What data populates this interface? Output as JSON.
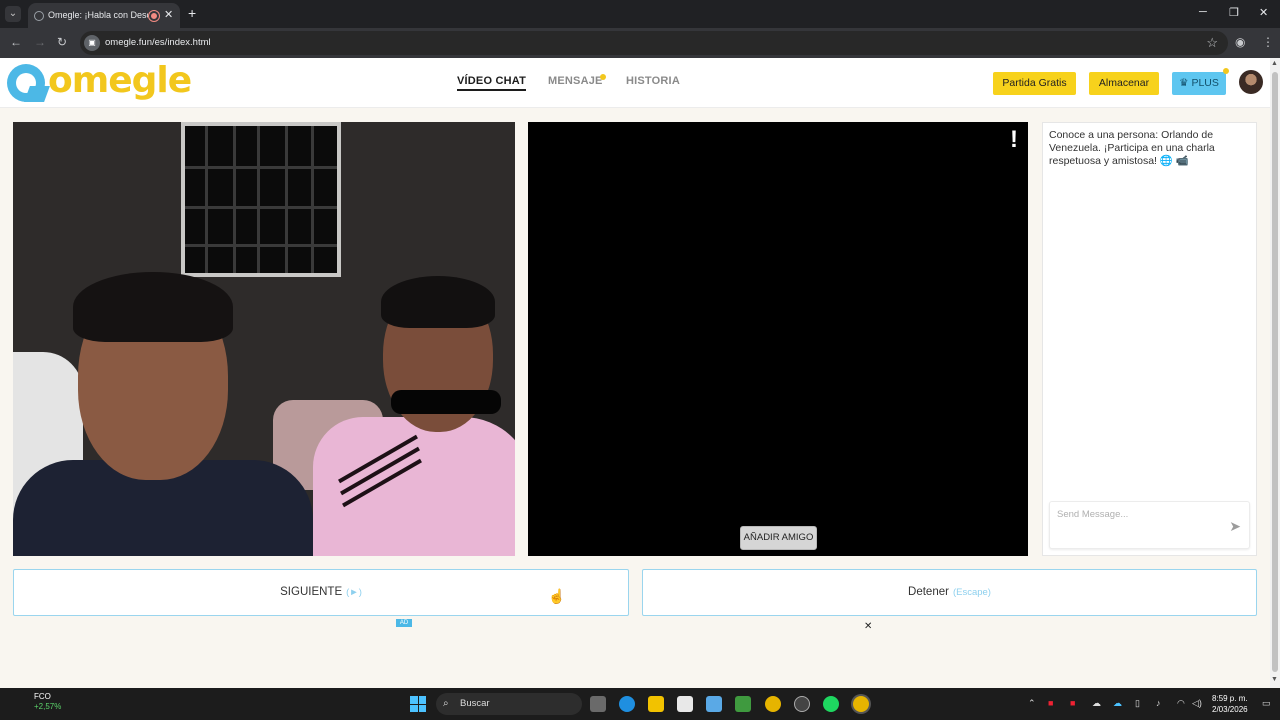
{
  "browser": {
    "tab_title": "Omegle: ¡Habla con Descon",
    "url": "omegle.fun/es/index.html",
    "new_tab": "+",
    "window_controls": [
      "─",
      "❐",
      "✕"
    ]
  },
  "header": {
    "logo_text": "omegle",
    "nav": [
      {
        "label": "VÍDEO CHAT",
        "active": true
      },
      {
        "label": "MENSAJE",
        "active": false
      },
      {
        "label": "HISTORIA",
        "active": false
      }
    ],
    "buttons": {
      "free_game": "Partida Gratis",
      "store": "Almacenar",
      "plus": "PLUS"
    }
  },
  "remote_video": {
    "report_icon": "!",
    "add_friend": "AÑADIR AMIGO"
  },
  "chat": {
    "system_message": "Conoce a una persona: Orlando de Venezuela. ¡Participa en una charla respetuosa y amistosa! 🌐 📹",
    "input_placeholder": "Send Message..."
  },
  "actions": {
    "next_label": "SIGUIENTE",
    "next_hint": "(►)",
    "stop_label": "Detener",
    "stop_hint": "(Escape)",
    "ad_tag": "AD",
    "ad_close": "✕"
  },
  "taskbar": {
    "weather_title": "FCO",
    "weather_change": "+2,57%",
    "search_label": "Buscar",
    "time": "8:59 p. m.",
    "date": "2/03/2026"
  },
  "colors": {
    "brand_yellow": "#f7d21c",
    "brand_blue": "#4cb8e6",
    "page_bg": "#f9f6f0"
  }
}
